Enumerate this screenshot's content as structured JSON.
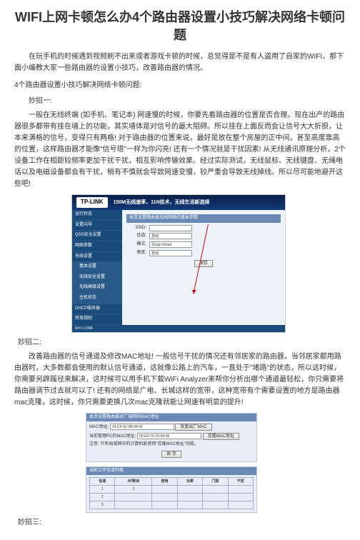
{
  "title": "WIFI上网卡顿怎么办4个路由器设置小技巧解决网络卡顿问题",
  "intro": "在玩手机的时候遇到视频刷不出来或者游戏卡顿的时候，总觉得是不是有人盗用了自家的WIFI，那下面小编教大家一些路由器的设置小技巧，改善路由器的情况。",
  "section_head": "4个路由器设置小技巧解决网络卡顿问题:",
  "tip1_head": "妙招一:",
  "tip1_para": "一般在无线终端 (如手机、笔记本) 网速慢的时候，你要先看路由器的位置是否合理。现在出产的路由器很多都带有挂在墙上的功能，其实墙体是对信号的最大阻碍。所以挂在上面反而会让信号大大折损，让本来满格的信号，变得只有两格! 对于路由器的位置来说，最好是放在整个房屋的正中间，甚至高度靠高的位置，这样路由器才能像\"信号塔\"一样为你闪亮! 还有一个情况就是干扰因素! 从无线通讯原理分析，2个设备工作在相距较频率更加干扰干扰，相互影响传输效果。经过实际测试，无线鼠标、无线键盘、无绳电话以及电磁设备都会有干扰，稍有不慎就会导致网速变慢，较严重会导致无线掉线。所以尽可能地避开这些吧!",
  "shot1": {
    "logo": "TP-LINK",
    "slogan": "150M无线速率，11N技术，无线生活新选择",
    "sidebar": [
      "运行状态",
      "设置向导",
      "QSS安全设置",
      "网络参数",
      "无线设置",
      "基本设置",
      "无线安全设置",
      "无线高级设置",
      "主机状态",
      "DHCP服务器",
      "转发规则"
    ],
    "panel_title": "本页设置路由器无线网络的基本参数",
    "labels": {
      "ssid": "SSID:",
      "channel": "信道:",
      "mode": "模式:",
      "bw": "频宽:"
    },
    "selects": {
      "channel": "自动",
      "mode": "11bgn mixed",
      "bw": "自动"
    },
    "buttons": {
      "save": "保存"
    },
    "bottom_note": "ID=1-C308-"
  },
  "tip2_head": "妙招二:",
  "tip2_para": "改善路由器的信号通道及修改MAC地址! 一般信号干扰的情况还有邻居家的路由器，当邻居家都用路由器时，大多数都会使用的默认信号通道，这就像公路上的汽车，一直处于\"堵路\"的状态，所以这时候，你需要另辟蹊径来解决，这时候可以用手机下载WiFi Analyzer来帮你分析出哪个通道最轻松，你只需要将路由器调节过去就可以了! 还有的网络是广电、长城这样的宽带，这种宽带有个需要设置的地方是路由器mac克隆，这时候，你只需要更换几次mac克隆就能让网速有明显的提升!",
  "shot2": {
    "panel1_title": "本页设置路由器对广域网的MAC地址",
    "mac_label": "MAC地址:",
    "mac_value": "14-CF-92-2B-58-42",
    "restore_btn": "恢复出厂MAC",
    "pc_mac_label": "当前管理PC的MAC地址:",
    "pc_mac_value": "00-E0-70-70-58-95",
    "clone_btn": "克隆MAC地址",
    "note": "注意: 只有局域网中的计算机能使用\"克隆MAC地址\"功能。",
    "save_btn": "保 存",
    "panel2_title": "当前工作信道列表",
    "cols": [
      "信道",
      "AP数目",
      "使用",
      "功率",
      "门限",
      "干扰"
    ],
    "rows": [
      [
        "1",
        "1",
        "",
        "",
        "",
        ""
      ],
      [
        "2",
        "",
        "",
        "",
        "",
        ""
      ],
      [
        "3",
        "",
        "",
        "",
        "",
        ""
      ]
    ]
  },
  "tip3_head": "妙招三:"
}
